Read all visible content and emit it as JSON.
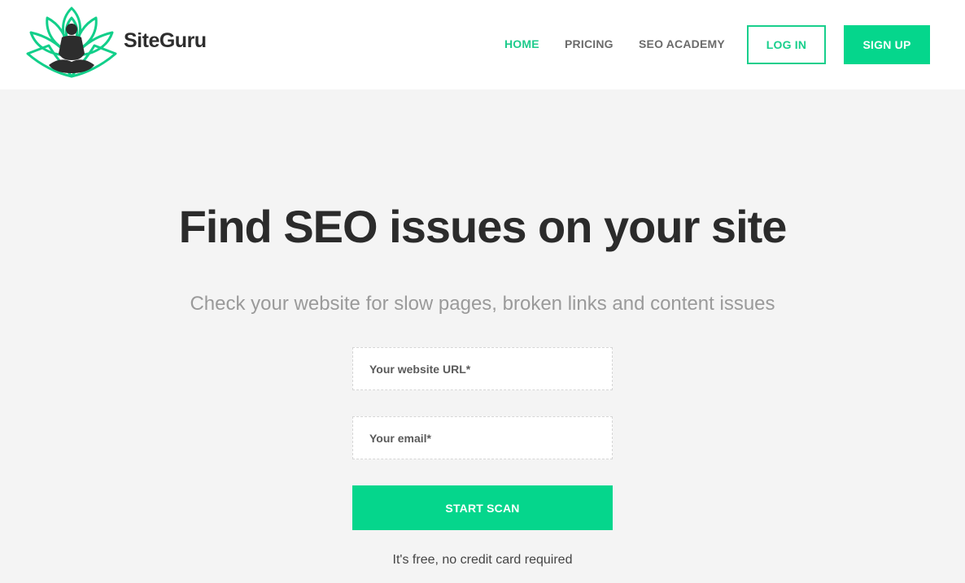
{
  "brand": {
    "name": "SiteGuru",
    "accent_color": "#05d68c",
    "logo_icon": "meditating-guru-lotus-icon"
  },
  "nav": {
    "items": [
      {
        "label": "HOME",
        "active": true
      },
      {
        "label": "PRICING",
        "active": false
      },
      {
        "label": "SEO ACADEMY",
        "active": false
      }
    ],
    "login_label": "LOG IN",
    "signup_label": "SIGN UP"
  },
  "hero": {
    "title": "Find SEO issues on your site",
    "subtitle": "Check your website for slow pages, broken links and content issues"
  },
  "form": {
    "url_placeholder": "Your website URL*",
    "url_value": "",
    "email_placeholder": "Your email*",
    "email_value": "",
    "submit_label": "START SCAN",
    "note": "It's free, no credit card required"
  }
}
